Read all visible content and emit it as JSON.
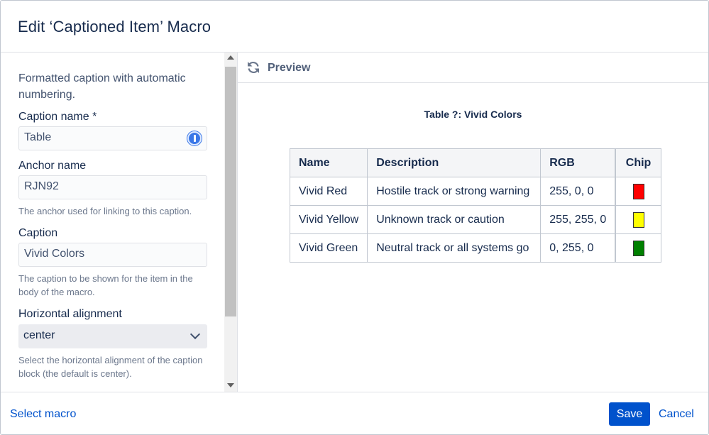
{
  "dialog": {
    "title": "Edit ‘Captioned Item’ Macro"
  },
  "form": {
    "description": "Formatted caption with automatic numbering.",
    "caption_name": {
      "label": "Caption name *",
      "value": "Table"
    },
    "anchor_name": {
      "label": "Anchor name",
      "value": "RJN92",
      "help": "The anchor used for linking to this caption."
    },
    "caption": {
      "label": "Caption",
      "value": "Vivid Colors",
      "help": "The caption to be shown for the item in the body of the macro."
    },
    "horizontal_alignment": {
      "label": "Horizontal alignment",
      "value": "center",
      "help": "Select the horizontal alignment of the caption block (the default is center)."
    }
  },
  "preview": {
    "label": "Preview",
    "caption_text": "Table ?: Vivid Colors",
    "table": {
      "headers": [
        "Name",
        "Description",
        "RGB",
        "Chip"
      ],
      "rows": [
        {
          "name": "Vivid Red",
          "description": "Hostile track or strong warning",
          "rgb": "255, 0, 0",
          "chip_color": "#ff0000"
        },
        {
          "name": "Vivid Yellow",
          "description": "Unknown track or caution",
          "rgb": "255, 255, 0",
          "chip_color": "#ffff00"
        },
        {
          "name": "Vivid Green",
          "description": "Neutral track or all systems go",
          "rgb": "0, 255, 0",
          "chip_color": "#008000"
        }
      ]
    }
  },
  "footer": {
    "select_macro": "Select macro",
    "save": "Save",
    "cancel": "Cancel"
  },
  "icons": {
    "refresh": "refresh-icon",
    "password_manager": "password-manager-icon",
    "dropdown": "chevron-down-icon"
  },
  "colors": {
    "primary": "#0052cc",
    "text": "#172b4d",
    "border": "#dfe1e6"
  }
}
